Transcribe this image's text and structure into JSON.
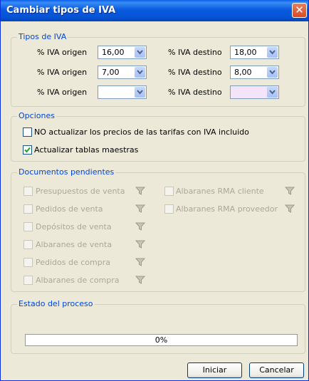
{
  "window": {
    "title": "Cambiar tipos de IVA",
    "close_glyph": "✕"
  },
  "tipos_iva": {
    "legend": "Tipos de IVA",
    "rows": [
      {
        "origen_label": "% IVA origen",
        "origen_value": "16,00",
        "destino_label": "% IVA destino",
        "destino_value": "18,00"
      },
      {
        "origen_label": "% IVA origen",
        "origen_value": "7,00",
        "destino_label": "% IVA destino",
        "destino_value": "8,00"
      },
      {
        "origen_label": "% IVA origen",
        "origen_value": "",
        "destino_label": "% IVA destino",
        "destino_value": ""
      }
    ]
  },
  "opciones": {
    "legend": "Opciones",
    "items": [
      {
        "label": "NO actualizar los precios de las tarifas con IVA incluido",
        "checked": false
      },
      {
        "label": "Actualizar tablas maestras",
        "checked": true
      }
    ]
  },
  "documentos": {
    "legend": "Documentos pendientes",
    "left": [
      {
        "label": "Presupuestos de venta"
      },
      {
        "label": "Pedidos de venta"
      },
      {
        "label": "Depósitos de venta"
      },
      {
        "label": "Albaranes de venta"
      },
      {
        "label": "Pedidos de compra"
      },
      {
        "label": "Albaranes de compra"
      }
    ],
    "right": [
      {
        "label": "Albaranes RMA cliente"
      },
      {
        "label": "Albaranes RMA proveedor"
      }
    ]
  },
  "estado": {
    "legend": "Estado del proceso",
    "progress_text": "0%",
    "progress": 0
  },
  "buttons": {
    "start": "Iniciar",
    "cancel": "Cancelar"
  },
  "colors": {
    "titlebar": "#0553D6",
    "legend": "#0046D5",
    "dialog_bg": "#ECE9D8",
    "disabled_text": "#ACA899"
  }
}
